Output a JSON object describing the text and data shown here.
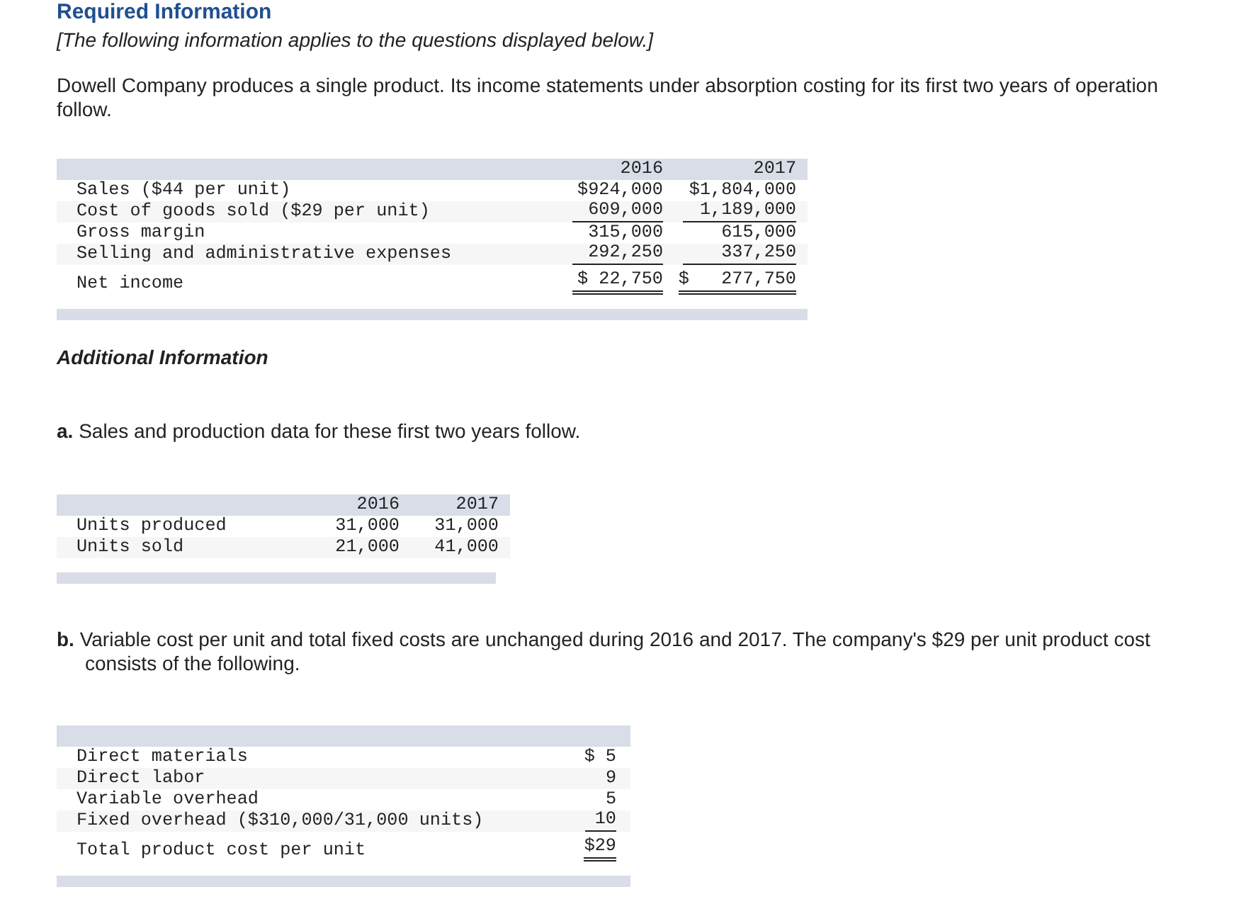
{
  "section_title": "Required Information",
  "note": "[The following information applies to the questions displayed below.]",
  "intro": "Dowell Company produces a single product. Its income statements under absorption costing for its first two years of operation follow.",
  "income_statement": {
    "columns": [
      "2016",
      "2017"
    ],
    "rows": [
      {
        "label": "Sales ($44 per unit)",
        "values": [
          "$924,000",
          "$1,804,000"
        ],
        "underlined": false,
        "total": false
      },
      {
        "label": "Cost of goods sold ($29 per unit)",
        "values": [
          "609,000",
          "1,189,000"
        ],
        "underlined": true,
        "total": false
      },
      {
        "label": "Gross margin",
        "values": [
          "315,000",
          "615,000"
        ],
        "underlined": false,
        "total": false
      },
      {
        "label": "Selling and administrative expenses",
        "values": [
          "292,250",
          "337,250"
        ],
        "underlined": true,
        "total": false
      },
      {
        "label": "Net income",
        "values": [
          "$ 22,750",
          "$   277,750"
        ],
        "underlined": false,
        "total": true
      }
    ]
  },
  "additional_heading": "Additional Information",
  "item_a": "**a.** Sales and production data for these first two years follow.",
  "units_table": {
    "columns": [
      "2016",
      "2017"
    ],
    "rows": [
      {
        "label": "Units produced",
        "values": [
          "31,000",
          "31,000"
        ]
      },
      {
        "label": "Units sold",
        "values": [
          "21,000",
          "41,000"
        ]
      }
    ]
  },
  "item_b": "**b.** Variable cost per unit and total fixed costs are unchanged during 2016 and 2017. The company's $29 per unit product cost consists of the following.",
  "cost_table": {
    "columns": [
      ""
    ],
    "rows": [
      {
        "label": "Direct materials",
        "values": [
          "$ 5"
        ],
        "underlined": false,
        "total": false
      },
      {
        "label": "Direct labor",
        "values": [
          "9"
        ],
        "underlined": false,
        "total": false
      },
      {
        "label": "Variable overhead",
        "values": [
          "5"
        ],
        "underlined": false,
        "total": false
      },
      {
        "label": "Fixed overhead ($310,000/31,000 units)",
        "values": [
          "10"
        ],
        "underlined": true,
        "total": false
      },
      {
        "label": "Total product cost per unit",
        "values": [
          "$29"
        ],
        "underlined": false,
        "total": true
      }
    ]
  }
}
